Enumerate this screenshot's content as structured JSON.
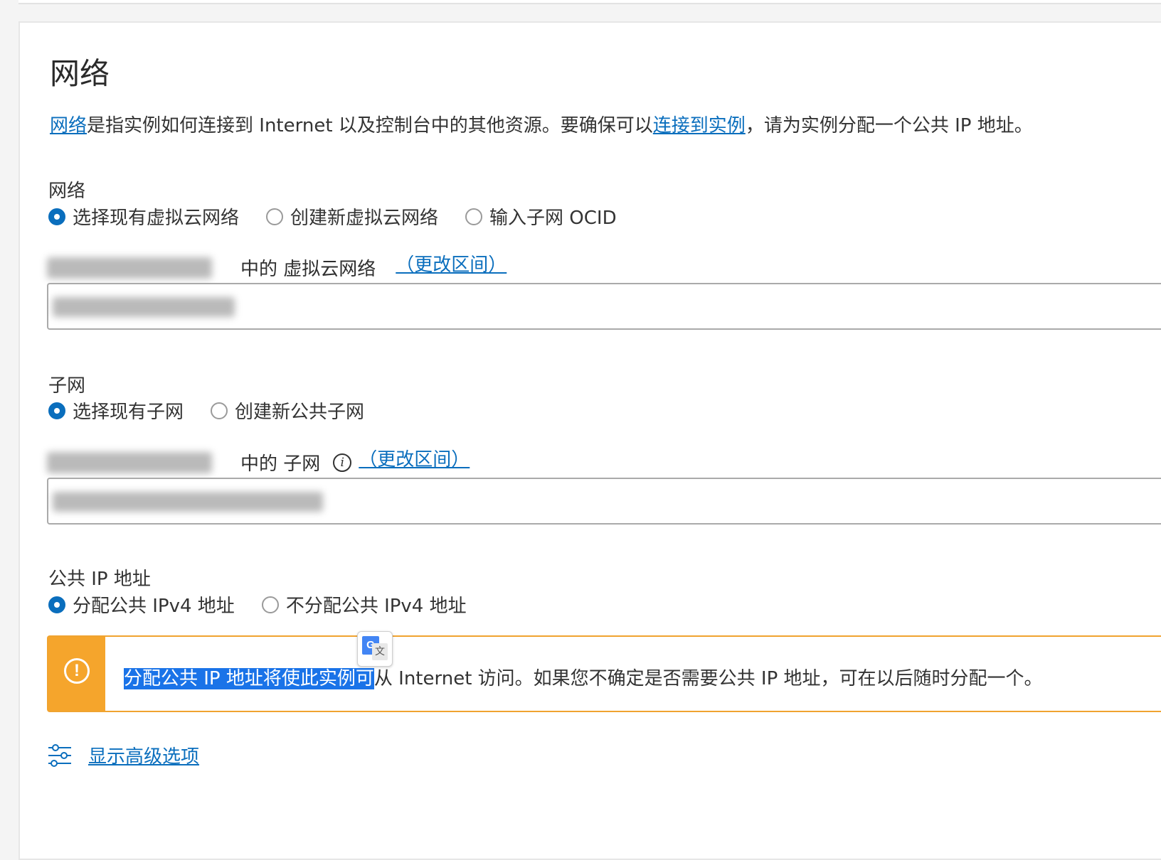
{
  "header": {
    "title": "网络"
  },
  "intro": {
    "link1": "网络",
    "text1": "是指实例如何连接到 Internet 以及控制台中的其他资源。要确保可以",
    "link2": "连接到实例",
    "text2": "，请为实例分配一个公共 IP 地址。"
  },
  "network": {
    "label": "网络",
    "options": [
      "选择现有虚拟云网络",
      "创建新虚拟云网络",
      "输入子网 OCID"
    ],
    "selected_index": 0,
    "scope_label": "中的 虚拟云网络",
    "change_link": "（更改区间）"
  },
  "subnet": {
    "label": "子网",
    "options": [
      "选择现有子网",
      "创建新公共子网"
    ],
    "selected_index": 0,
    "scope_label": "中的 子网",
    "change_link": "（更改区间）"
  },
  "public_ip": {
    "label": "公共 IP 地址",
    "options": [
      "分配公共 IPv4 地址",
      "不分配公共 IPv4 地址"
    ],
    "selected_index": 0
  },
  "warning": {
    "highlighted_text": "分配公共 IP 地址将使此实例可",
    "text": "从 Internet 访问。如果您不确定是否需要公共 IP 地址，可在以后随时分配一个。",
    "icon": "exclamation-circle-icon"
  },
  "translate_badge": {
    "g": "G",
    "w": "文"
  },
  "advanced": {
    "label": "显示高级选项",
    "icon": "sliders-icon"
  },
  "colors": {
    "accent": "#0a6ebd",
    "warning": "#f5a52c",
    "highlight": "#1a73e8"
  }
}
